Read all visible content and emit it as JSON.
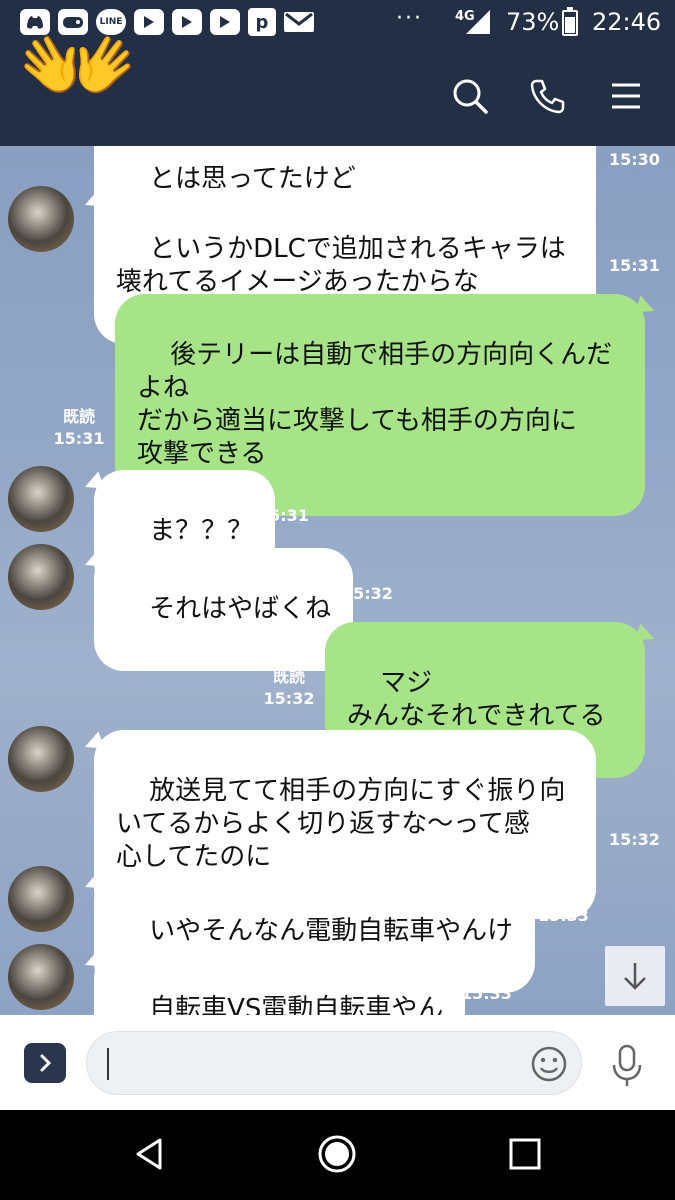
{
  "status_bar": {
    "line_icon_text": "LINE",
    "p_icon_text": "p",
    "more_dots": "···",
    "network": "4G",
    "battery": "73%",
    "battery_level": 0.73,
    "time": "22:46",
    "notification_icons": [
      "discord-icon",
      "game-icon",
      "line-icon",
      "youtube-icon",
      "youtube-icon",
      "youtube-icon",
      "pixiv-icon",
      "mail-icon"
    ]
  },
  "header": {
    "sticker": "👐",
    "icons": [
      "search-icon",
      "phone-icon",
      "menu-icon"
    ]
  },
  "messages": [
    {
      "side": "in",
      "text": "とは思ってたけど",
      "time": "15:30",
      "avatar": false
    },
    {
      "side": "in",
      "text": "というかDLCで追加されるキャラは\n壊れてるイメージあったからな",
      "time": "15:31",
      "avatar": true
    },
    {
      "side": "out",
      "text": "後テリーは自動で相手の方向向くんだ\nよね\nだから適当に攻撃しても相手の方向に\n攻撃できる",
      "read": "既読",
      "time": "15:31"
    },
    {
      "side": "in",
      "text": "ま？？？",
      "time": "15:31",
      "avatar": true
    },
    {
      "side": "in",
      "text": "それはやばくね",
      "time": "15:32",
      "avatar": true
    },
    {
      "side": "out",
      "text": "マジ\nみんなそれできれてる",
      "read": "既読",
      "time": "15:32"
    },
    {
      "side": "in",
      "text": "放送見てて相手の方向にすぐ振り向\nいてるからよく切り返すな〜って感\n心してたのに",
      "time": "15:32",
      "avatar": true
    },
    {
      "side": "in",
      "text": "いやそんなん電動自転車やんけ",
      "time": "15:33",
      "avatar": true
    },
    {
      "side": "in",
      "text": "自転車VS電動自転車やん",
      "time": "15:33",
      "avatar": true
    }
  ],
  "input": {
    "value": "",
    "icons": [
      "chevron-right-icon",
      "emoji-icon",
      "mic-icon"
    ]
  },
  "nav": {
    "icons": [
      "back-icon",
      "home-icon",
      "recents-icon"
    ]
  }
}
